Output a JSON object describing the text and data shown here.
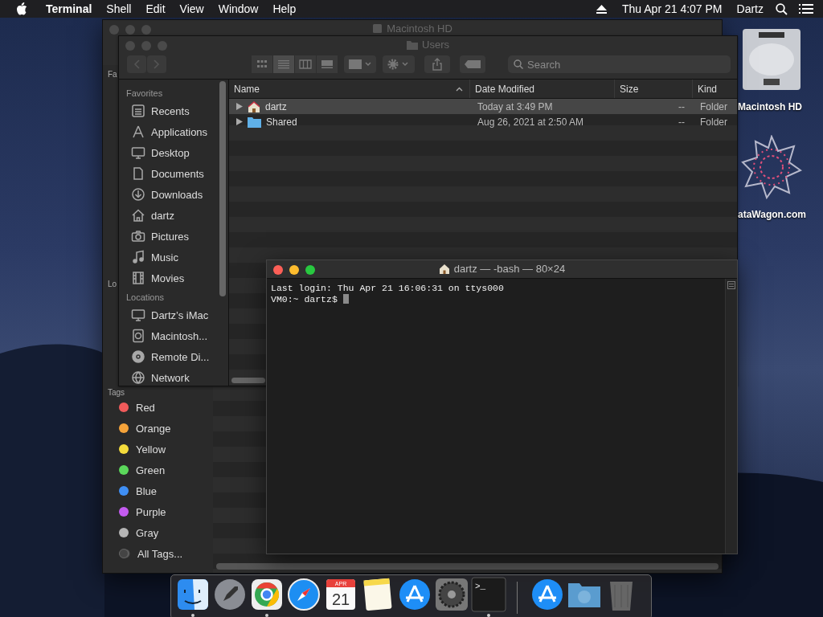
{
  "menubar": {
    "app": "Terminal",
    "menus": [
      "Shell",
      "Edit",
      "View",
      "Window",
      "Help"
    ],
    "clock": "Thu Apr 21  4:07 PM",
    "user": "Dartz"
  },
  "desktop_icons": [
    {
      "kind": "drive",
      "label": "Macintosh HD"
    },
    {
      "kind": "logo",
      "label": "ataWagon.com"
    }
  ],
  "back_finder": {
    "title": "Macintosh HD",
    "active": false,
    "sidebar_headings": [
      "Fa",
      "Lo"
    ],
    "tags_heading": "Tags",
    "tags": [
      {
        "label": "Red",
        "color": "#f05b5b"
      },
      {
        "label": "Orange",
        "color": "#f5a33a"
      },
      {
        "label": "Yellow",
        "color": "#f5dc3c"
      },
      {
        "label": "Green",
        "color": "#5bd85b"
      },
      {
        "label": "Blue",
        "color": "#3f8ff5"
      },
      {
        "label": "Purple",
        "color": "#c45bf0"
      },
      {
        "label": "Gray",
        "color": "#b5b5b5"
      }
    ],
    "all_tags": "All Tags..."
  },
  "front_finder": {
    "title": "Users",
    "active": false,
    "views": [
      {
        "kind": "icons",
        "selected": false
      },
      {
        "kind": "list",
        "selected": true
      },
      {
        "kind": "columns",
        "selected": false
      },
      {
        "kind": "gallery",
        "selected": false
      }
    ],
    "search": {
      "placeholder": "Search"
    },
    "sidebar": [
      {
        "heading": "Favorites",
        "items": [
          {
            "kind": "recents",
            "label": "Recents"
          },
          {
            "kind": "applications",
            "label": "Applications"
          },
          {
            "kind": "desktop",
            "label": "Desktop"
          },
          {
            "kind": "documents",
            "label": "Documents"
          },
          {
            "kind": "downloads",
            "label": "Downloads"
          },
          {
            "kind": "home",
            "label": "dartz"
          },
          {
            "kind": "pictures",
            "label": "Pictures"
          },
          {
            "kind": "music",
            "label": "Music"
          },
          {
            "kind": "movies",
            "label": "Movies"
          }
        ]
      },
      {
        "heading": "Locations",
        "items": [
          {
            "kind": "computer",
            "label": "Dartz’s iMac"
          },
          {
            "kind": "drive",
            "label": "Macintosh..."
          },
          {
            "kind": "disc",
            "label": "Remote Di..."
          },
          {
            "kind": "network",
            "label": "Network"
          }
        ]
      }
    ],
    "columns": [
      "Name",
      "Date Modified",
      "Size",
      "Kind"
    ],
    "rows": [
      {
        "kind": "home",
        "name": "dartz",
        "date": "Today at 3:49 PM",
        "size": "--",
        "kind_text": "Folder",
        "expanded": false,
        "selected": true
      },
      {
        "kind": "folder",
        "name": "Shared",
        "date": "Aug 26, 2021 at 2:50 AM",
        "size": "--",
        "kind_text": "Folder",
        "expanded": false,
        "selected": false
      }
    ]
  },
  "terminal": {
    "title": "dartz — -bash — 80×24",
    "active": true,
    "lines": [
      "Last login: Thu Apr 21 16:06:31 on ttys000",
      "VM0:~ dartz$ "
    ]
  },
  "dock": [
    {
      "kind": "finder",
      "running": true
    },
    {
      "kind": "launchpad",
      "running": false
    },
    {
      "kind": "chrome",
      "running": true
    },
    {
      "kind": "safari",
      "running": false
    },
    {
      "kind": "calendar",
      "month": "APR",
      "day": "21",
      "running": false
    },
    {
      "kind": "notes",
      "running": false
    },
    {
      "kind": "appstore",
      "running": false
    },
    {
      "kind": "settings",
      "running": false
    },
    {
      "kind": "terminal",
      "glyph": ">_",
      "running": true
    },
    {
      "kind": "separator"
    },
    {
      "kind": "appstore",
      "running": false
    },
    {
      "kind": "downloads",
      "running": false
    },
    {
      "kind": "trash",
      "running": false
    }
  ]
}
